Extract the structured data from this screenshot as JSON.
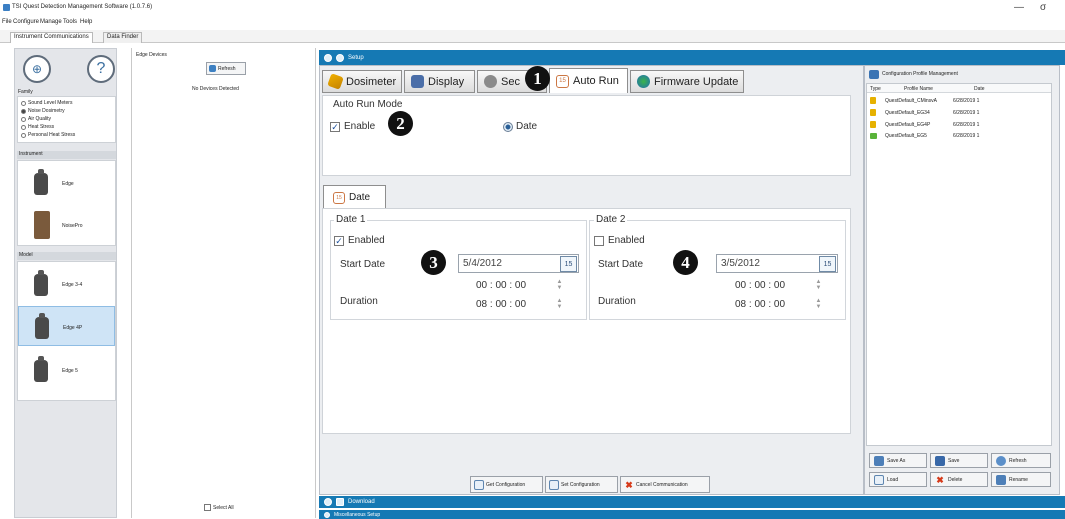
{
  "window": {
    "title": "TSI Quest Detection Management Software (1.0.7.6)",
    "minimize": "—",
    "restore": "σ"
  },
  "menu": [
    "File",
    "Configure",
    "Manage",
    "Tools",
    "Help"
  ],
  "top_tabs": [
    "Instrument Communications",
    "Data Finder"
  ],
  "left": {
    "family_label": "Family",
    "family_options": [
      {
        "label": "Sound Level Meters",
        "selected": false
      },
      {
        "label": "Noise Dosimetry",
        "selected": true
      },
      {
        "label": "Air Quality",
        "selected": false
      },
      {
        "label": "Heat Stress",
        "selected": false
      },
      {
        "label": "Personal Heat Stress",
        "selected": false
      }
    ],
    "instrument_label": "Instrument",
    "instruments": [
      "Edge",
      "NoisePro"
    ],
    "model_label": "Model",
    "models": [
      "Edge 3-4",
      "Edge 4P",
      "Edge 5"
    ],
    "selected_model": "Edge 4P"
  },
  "edge_devices": {
    "title": "Edge Devices",
    "refresh": "Refresh",
    "status": "No Devices Detected",
    "select_all": "Select All"
  },
  "setup": {
    "header": "Setup",
    "tabs": [
      "Dosimeter",
      "Display",
      "Sec",
      "Auto Run",
      "Firmware Update"
    ],
    "active_tab": "Auto Run",
    "auto_run_mode": "Auto Run Mode",
    "enable_label": "Enable",
    "enable_checked": true,
    "date_radio": "Date",
    "sub_tab": "Date",
    "date1": {
      "title": "Date 1",
      "enabled_label": "Enabled",
      "enabled": true,
      "start_label": "Start Date",
      "start_date": "5/4/2012",
      "time": "00 : 00 : 00",
      "duration_label": "Duration",
      "duration": "08 : 00 : 00"
    },
    "date2": {
      "title": "Date 2",
      "enabled_label": "Enabled",
      "enabled": false,
      "start_label": "Start Date",
      "start_date": "3/5/2012",
      "time": "00 : 00 : 00",
      "duration_label": "Duration",
      "duration": "08 : 00 : 00"
    },
    "calendar_label": "15",
    "buttons": {
      "get": "Get Configuration",
      "set": "Set Configuration",
      "cancel": "Cancel Communication"
    }
  },
  "download_header": "Download",
  "misc_header": "Miscellaneous Setup",
  "config_profile": {
    "title": "Configuration Profile Management",
    "columns": [
      "Type",
      "Profile Name",
      "Date"
    ],
    "rows": [
      {
        "name": "QuestDefault_CMinsvA",
        "date": "6/28/2019 1"
      },
      {
        "name": "QuestDefault_EG34",
        "date": "6/28/2019 1"
      },
      {
        "name": "QuestDefault_EG4P",
        "date": "6/28/2019 1"
      },
      {
        "name": "QuestDefault_EG5",
        "date": "6/28/2019 1"
      }
    ],
    "buttons": {
      "save_as": "Save As",
      "save": "Save",
      "refresh": "Refresh",
      "load": "Load",
      "delete": "Delete",
      "rename": "Rename"
    }
  },
  "badges": [
    "1",
    "2",
    "3",
    "4"
  ],
  "colors": {
    "accent": "#1579b4"
  }
}
